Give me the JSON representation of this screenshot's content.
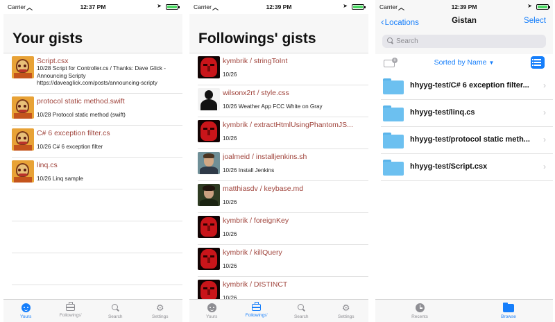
{
  "screens": [
    {
      "status": {
        "carrier": "Carrier",
        "time": "12:37 PM"
      },
      "title": "Your gists",
      "rows": [
        {
          "avatar": "pixel-character",
          "title": "Script.csx",
          "desc": "10/28 Script for Controller.cs / Thanks: Dave Glick - Announcing Scripty https://daveaglick.com/posts/announcing-scripty"
        },
        {
          "avatar": "pixel-character",
          "title": "protocol static method.swift",
          "desc": "10/28 Protocol static method (swift)"
        },
        {
          "avatar": "pixel-character",
          "title": "C# 6 exception filter.cs",
          "desc": "10/26 C# 6 exception filter"
        },
        {
          "avatar": "pixel-character",
          "title": "linq.cs",
          "desc": "10/26 Linq sample"
        }
      ],
      "tabs": [
        {
          "label": "Yours",
          "icon": "face-icon",
          "active": true
        },
        {
          "label": "Followings'",
          "icon": "briefcase-icon",
          "active": false
        },
        {
          "label": "Search",
          "icon": "search-icon",
          "active": false
        },
        {
          "label": "Settings",
          "icon": "gear-icon",
          "active": false
        }
      ]
    },
    {
      "status": {
        "carrier": "Carrier",
        "time": "12:39 PM"
      },
      "title": "Followings' gists",
      "rows": [
        {
          "avatar": "red-face",
          "title": "kymbrik / stringToInt",
          "desc": "10/26"
        },
        {
          "avatar": "default-person",
          "title": "wilsonx2rt / style.css",
          "desc": "10/26 Weather App FCC White on Gray"
        },
        {
          "avatar": "red-face",
          "title": "kymbrik / extractHtmlUsingPhantomJS...",
          "desc": "10/26"
        },
        {
          "avatar": "photo-1",
          "title": "joalmeid / installjenkins.sh",
          "desc": "10/26 Install Jenkins"
        },
        {
          "avatar": "photo-2",
          "title": "matthiasdv / keybase.md",
          "desc": "10/26"
        },
        {
          "avatar": "red-face",
          "title": "kymbrik / foreignKey",
          "desc": "10/26"
        },
        {
          "avatar": "red-face",
          "title": "kymbrik / killQuery",
          "desc": "10/26"
        },
        {
          "avatar": "red-face",
          "title": "kymbrik / DISTINCT",
          "desc": "10/26"
        }
      ],
      "tabs": [
        {
          "label": "Yours",
          "icon": "face-icon",
          "active": false
        },
        {
          "label": "Followings'",
          "icon": "briefcase-icon",
          "active": true
        },
        {
          "label": "Search",
          "icon": "search-icon",
          "active": false
        },
        {
          "label": "Settings",
          "icon": "gear-icon",
          "active": false
        }
      ]
    },
    {
      "status": {
        "carrier": "Carrier",
        "time": "12:39 PM"
      },
      "back_label": "Locations",
      "title": "Gistan",
      "select_label": "Select",
      "search_placeholder": "Search",
      "sort_label": "Sorted by Name",
      "files": [
        {
          "name": "hhyyg-test/C# 6 exception filter..."
        },
        {
          "name": "hhyyg-test/linq.cs"
        },
        {
          "name": "hhyyg-test/protocol static meth..."
        },
        {
          "name": "hhyyg-test/Script.csx"
        }
      ],
      "tabs": [
        {
          "label": "Recents",
          "icon": "clock-icon",
          "active": false
        },
        {
          "label": "Browse",
          "icon": "folder-icon",
          "active": true
        }
      ]
    }
  ],
  "colors": {
    "accent": "#157efb",
    "gist_title": "#a0443c",
    "inactive": "#8e8e93"
  }
}
